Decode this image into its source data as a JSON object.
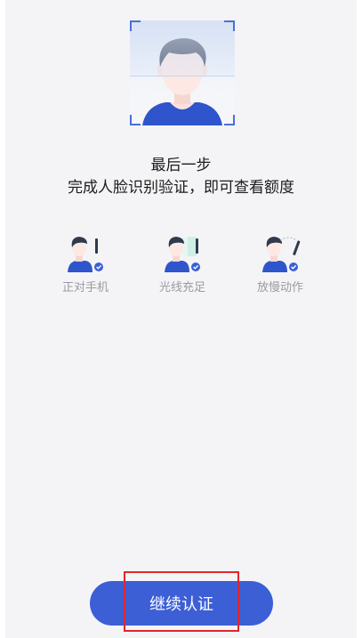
{
  "heading": {
    "line1": "最后一步",
    "line2": "完成人脸识别验证，即可查看额度"
  },
  "tips": [
    {
      "label": "正对手机",
      "icon": "person-facing-phone-icon"
    },
    {
      "label": "光线充足",
      "icon": "person-good-light-icon"
    },
    {
      "label": "放慢动作",
      "icon": "person-slow-motion-icon"
    }
  ],
  "button": {
    "label": "继续认证"
  },
  "colors": {
    "accent": "#3c5fd6",
    "highlight": "#e0262c",
    "background": "#f4f4f6",
    "hair": "#2f3a4d",
    "skin": "#fde8e4",
    "check": "#3c5fd6"
  }
}
